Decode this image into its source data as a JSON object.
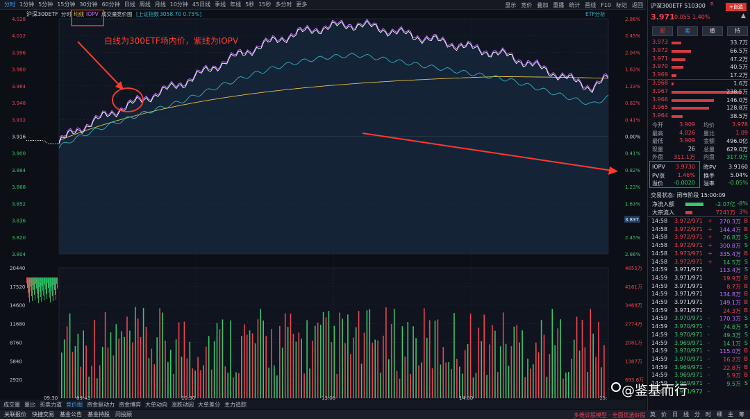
{
  "toolbar": {
    "items": [
      "分时",
      "1分钟",
      "5分钟",
      "15分钟",
      "30分钟",
      "60分钟",
      "日线",
      "周线",
      "月线",
      "10分钟",
      "45日线",
      "季线",
      "年线",
      "5秒",
      "15秒",
      "多分时",
      "更多"
    ],
    "right": [
      "显示",
      "竞价",
      "叠加",
      "重播",
      "统计",
      "画线",
      "F10",
      "标记",
      "返回"
    ]
  },
  "chart": {
    "title": "沪深300ETF",
    "tabs": [
      "分时",
      "均线",
      "IOPV",
      "成交量",
      "竞价图"
    ],
    "index_label": "[上证指数",
    "index_value": "3058.70 0.75%]",
    "etf_analysis": "ETF分析",
    "price_ticks": [
      "4.028",
      "4.012",
      "3.996",
      "3.980",
      "3.964",
      "3.948",
      "3.932",
      "3.916",
      "3.900",
      "3.884",
      "3.868",
      "3.852",
      "3.836",
      "3.820",
      "3.804"
    ],
    "pct_ticks": [
      "2.86%",
      "2.45%",
      "2.04%",
      "1.63%",
      "1.23%",
      "0.82%",
      "0.41%",
      "0.00%",
      "0.41%",
      "0.82%",
      "1.23%",
      "1.63%",
      "2.04%",
      "2.45%",
      "2.86%"
    ],
    "vol_ticks": [
      "20440",
      "17520",
      "14600",
      "11680",
      "8760",
      "5840",
      "2920"
    ],
    "vol_ticks_right": [
      "4855万",
      "4161万",
      "3468万",
      "2774万",
      "2081万",
      "1387万",
      "693.6万"
    ],
    "time_ticks": [
      "09:30",
      "09:43",
      "10:30",
      "13:00",
      "14:00",
      "15:"
    ],
    "cursor_price": "3.837",
    "annotation": "白线为300ETF场内价，紫线为IOPV"
  },
  "statusbar": [
    "成交量",
    "量比",
    "买卖力道",
    "竞价图",
    "资金驱动力",
    "资金博弈",
    "大单动向",
    "涨跌动因",
    "大单差分",
    "主力追踪"
  ],
  "bottombar": [
    "关联报价",
    "快捷交易",
    "基金公告",
    "基金持股",
    "问投顾"
  ],
  "bottom_promo": "多维诊股模型 · 全面优选好股",
  "bottom_right": [
    "英",
    "价",
    "日",
    "线",
    "分",
    "时",
    "细",
    "主",
    "筹"
  ],
  "watermark": "@鉴基而行",
  "right": {
    "title": "沪深300ETF 510300",
    "badge": "R",
    "price": "3.971",
    "change": "0.055",
    "pct": "1.40%",
    "buttons": [
      "买",
      "卖",
      "撤",
      "持"
    ],
    "asks": [
      {
        "p": "3.973",
        "v": "33.7万"
      },
      {
        "p": "3.972",
        "v": "66.5万"
      },
      {
        "p": "3.971",
        "v": "47.2万"
      },
      {
        "p": "3.970",
        "v": "40.5万"
      },
      {
        "p": "3.969",
        "v": "17.2万"
      }
    ],
    "bids": [
      {
        "p": "3.968",
        "v": "1.6万"
      },
      {
        "p": "3.967",
        "v": "238.5万"
      },
      {
        "p": "3.966",
        "v": "146.0万"
      },
      {
        "p": "3.965",
        "v": "128.8万"
      },
      {
        "p": "3.964",
        "v": "38.5万"
      }
    ],
    "stats": [
      [
        "今开",
        "3.909",
        "均价",
        "3.978"
      ],
      [
        "最高",
        "4.026",
        "量比",
        "1.09"
      ],
      [
        "最低",
        "3.909",
        "金额",
        "496.0亿"
      ],
      [
        "现量",
        "26",
        "总量",
        "629.0万"
      ],
      [
        "外盘",
        "311.1万",
        "内盘",
        "317.9万"
      ]
    ],
    "iopv": [
      [
        "IOPV",
        "3.9730",
        "昨PV",
        "3.9160"
      ],
      [
        "PV涨",
        "1.46%",
        "换手",
        "5.04%"
      ],
      [
        "溢价",
        "-0.0020",
        "溢率",
        "-0.05%"
      ]
    ],
    "state": "交易状态: 闭市阶段 15:00:09",
    "flows": [
      {
        "l": "净流入额",
        "v": "-2.07亿",
        "p": "-8%"
      },
      {
        "l": "大宗流入",
        "v": "7241万",
        "p": "3%"
      }
    ],
    "trades": [
      [
        "14:58",
        "3.972/971",
        "+",
        "270.3万",
        "B"
      ],
      [
        "14:58",
        "3.972/971",
        "+",
        "144.4万",
        "B"
      ],
      [
        "14:58",
        "3.972/971",
        "+",
        "26.8万",
        "S"
      ],
      [
        "14:58",
        "3.972/971",
        "+",
        "300.8万",
        "S"
      ],
      [
        "14:58",
        "3.973/971",
        "+",
        "335.4万",
        "B"
      ],
      [
        "14:58",
        "3.972/971",
        "+",
        "14.5万",
        "S"
      ],
      [
        "14:59",
        "3.971/971",
        "",
        "113.4万",
        "S"
      ],
      [
        "14:59",
        "3.971/971",
        "",
        "19.9万",
        "B"
      ],
      [
        "14:59",
        "3.971/971",
        "",
        "8.7万",
        "B"
      ],
      [
        "14:59",
        "3.971/971",
        "",
        "134.8万",
        "B"
      ],
      [
        "14:59",
        "3.971/971",
        "",
        "149.1万",
        "B"
      ],
      [
        "14:59",
        "3.971/971",
        "",
        "24.3万",
        "B"
      ],
      [
        "14:59",
        "3.970/971",
        "-",
        "170.3万",
        "S"
      ],
      [
        "14:59",
        "3.970/971",
        "-",
        "74.8万",
        "S"
      ],
      [
        "14:59",
        "3.970/971",
        "-",
        "49.3万",
        "S"
      ],
      [
        "14:59",
        "3.969/971",
        "-",
        "14.1万",
        "S"
      ],
      [
        "14:59",
        "3.970/971",
        "-",
        "115.0万",
        "B"
      ],
      [
        "14:59",
        "3.970/971",
        "-",
        "16.2万",
        "B"
      ],
      [
        "14:59",
        "3.969/971",
        "-",
        "22.8万",
        "B"
      ],
      [
        "14:59",
        "3.969/971",
        "-",
        "5.9万",
        "B"
      ],
      [
        "14:59",
        "3.969/971",
        "-",
        "9.5万",
        "S"
      ],
      [
        "15:00",
        "3.971/972",
        "-",
        "",
        ""
      ]
    ]
  },
  "colors": {
    "red": "#ef4452",
    "green": "#3dc36c",
    "white": "#ffffff",
    "purple": "#c070ff",
    "yellow": "#e6c24a",
    "cyan": "#2fb4c4"
  }
}
